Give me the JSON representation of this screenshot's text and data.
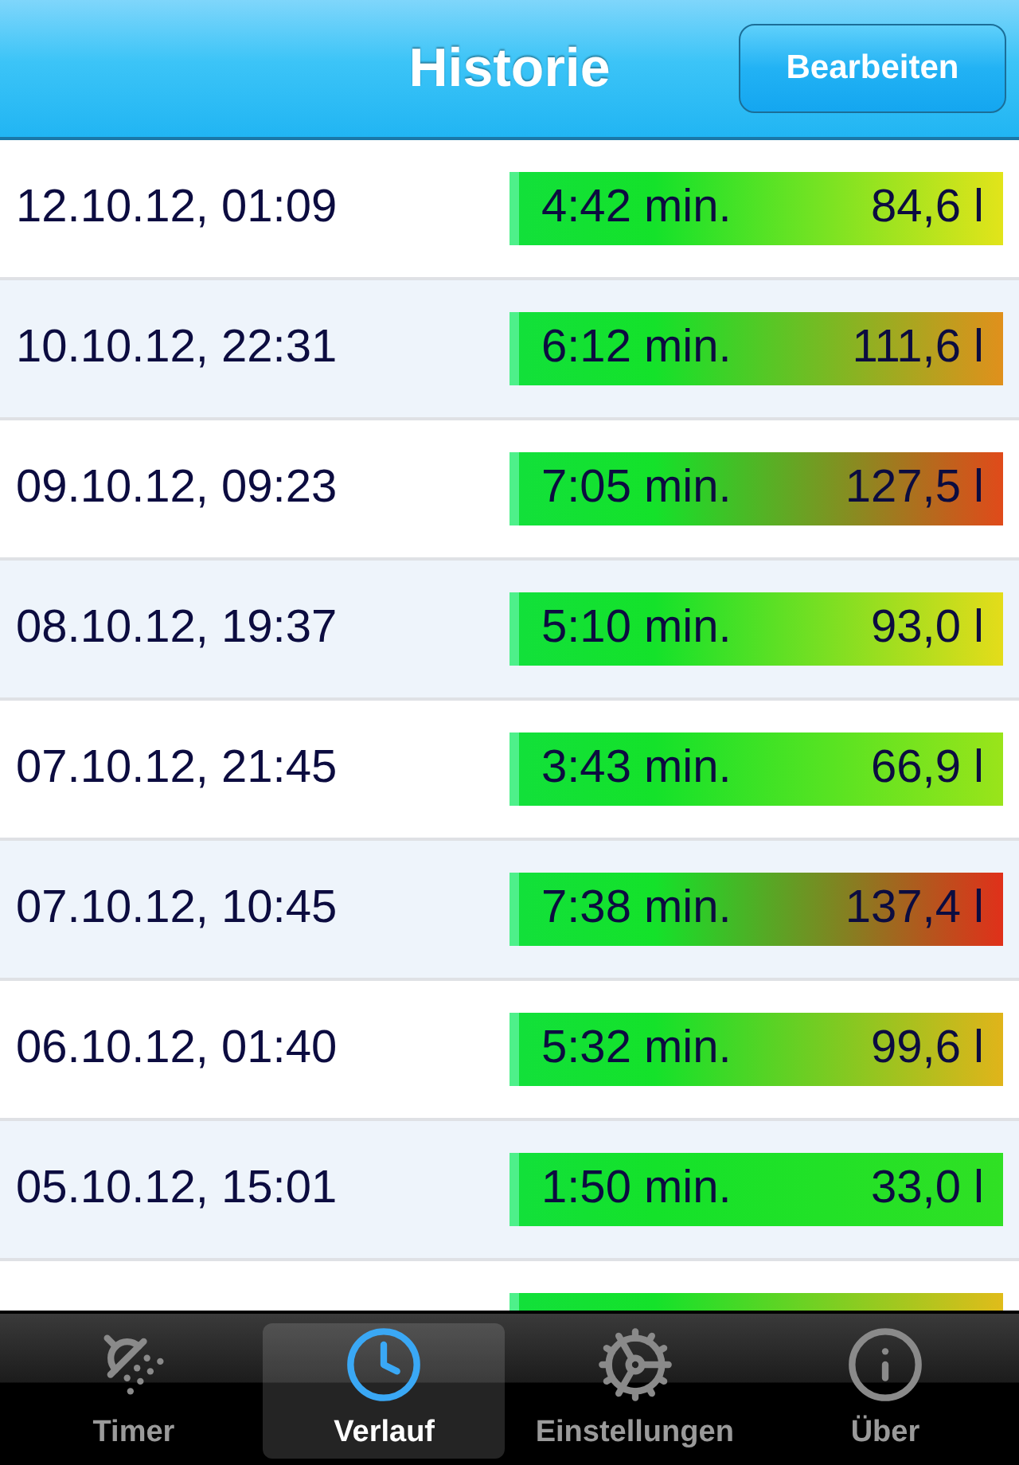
{
  "nav": {
    "title": "Historie",
    "edit_button": "Bearbeiten"
  },
  "rows": [
    {
      "kind": "full",
      "date": "12.10.12, 01:09",
      "duration": "4:42 min.",
      "volume": "84,6 l",
      "color": "#e2e41a"
    },
    {
      "kind": "full",
      "date": "10.10.12, 22:31",
      "duration": "6:12 min.",
      "volume": "111,6 l",
      "color": "#e0901c"
    },
    {
      "kind": "full",
      "date": "09.10.12, 09:23",
      "duration": "7:05 min.",
      "volume": "127,5 l",
      "color": "#e04a1a"
    },
    {
      "kind": "full",
      "date": "08.10.12, 19:37",
      "duration": "5:10 min.",
      "volume": "93,0 l",
      "color": "#e4dc1a"
    },
    {
      "kind": "full",
      "date": "07.10.12, 21:45",
      "duration": "3:43 min.",
      "volume": "66,9 l",
      "color": "#9ae41a"
    },
    {
      "kind": "full",
      "date": "07.10.12, 10:45",
      "duration": "7:38 min.",
      "volume": "137,4 l",
      "color": "#e0301a"
    },
    {
      "kind": "full",
      "date": "06.10.12, 01:40",
      "duration": "5:32 min.",
      "volume": "99,6 l",
      "color": "#e0b41a"
    },
    {
      "kind": "full",
      "date": "05.10.12, 15:01",
      "duration": "1:50 min.",
      "volume": "33,0 l",
      "color": "#30e024"
    },
    {
      "kind": "partial",
      "color": "#e0bc1a"
    }
  ],
  "tabs": [
    {
      "kind": "shower",
      "label": "Timer",
      "selected": false
    },
    {
      "kind": "clock",
      "label": "Verlauf",
      "selected": true
    },
    {
      "kind": "gears",
      "label": "Einstellungen",
      "selected": false
    },
    {
      "kind": "info",
      "label": "Über",
      "selected": false
    }
  ]
}
